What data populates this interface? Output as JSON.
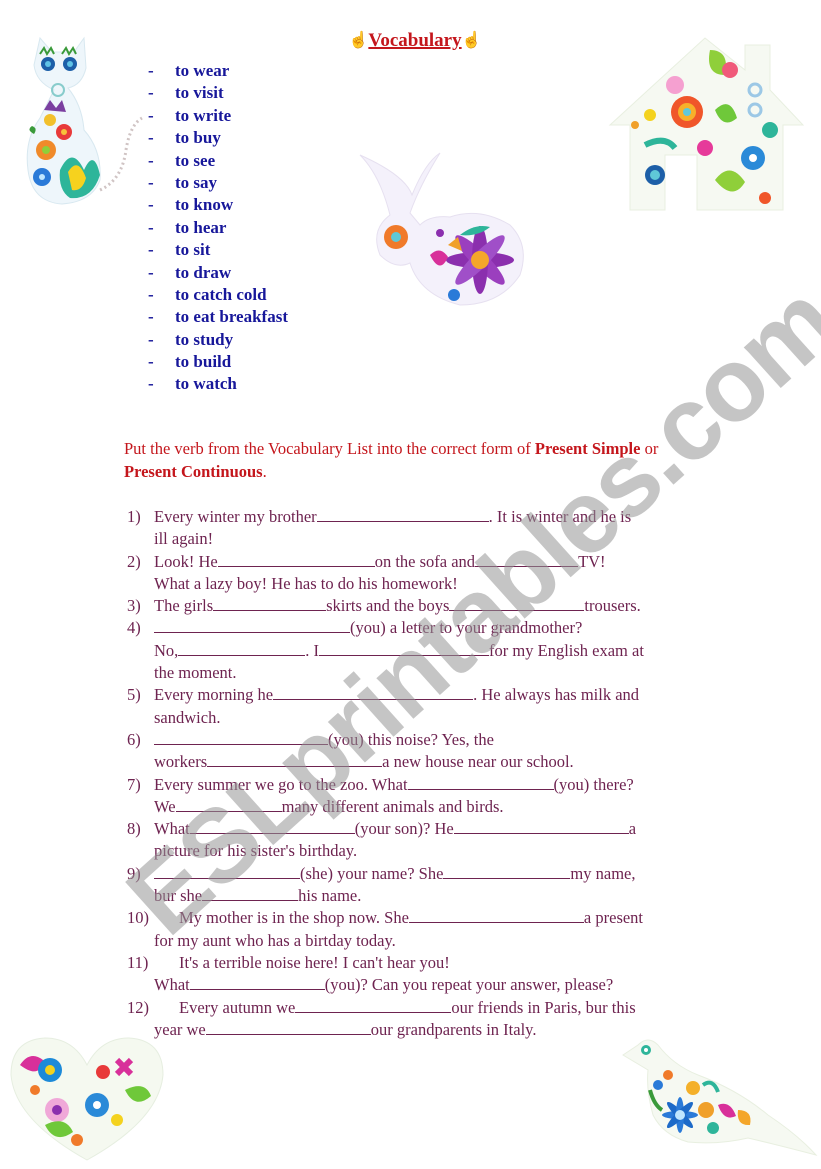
{
  "title": {
    "text": "Vocabulary",
    "left_icon": "pointing-hand-icon",
    "right_icon": "pointing-hand-icon",
    "color": "#c4161c"
  },
  "vocabulary": {
    "bullet": "-",
    "color": "#17179a",
    "items": [
      "to wear",
      "to visit",
      "to write",
      "to buy",
      "to see",
      "to say",
      "to know",
      "to hear",
      "to sit",
      "to draw",
      "to catch cold",
      "to eat breakfast",
      "to study",
      "to build",
      "to watch"
    ]
  },
  "instructions": {
    "part1": "Put the verb from the Vocabulary List into the correct form of ",
    "bold1": "Present Simple",
    "part2": " or ",
    "bold2": "Present Continuous",
    "part3": ".",
    "color": "#c4161c"
  },
  "exercises": {
    "color": "#6e2350",
    "items": [
      {
        "num": "1)",
        "a": "Every winter my brother",
        "b": ". It is winter and he is",
        "c": "ill again!"
      },
      {
        "num": "2)",
        "a": "Look! He",
        "b": "on the sofa and",
        "c": "TV!",
        "d": "What a lazy boy! He has to do his homework!"
      },
      {
        "num": "3)",
        "a": "The girls",
        "b": "skirts and the boys",
        "c": "trousers."
      },
      {
        "num": "4)",
        "a": "(you) a letter to your grandmother?",
        "b": "No,",
        "c": ". I",
        "d": "for my English exam at",
        "e": "the moment."
      },
      {
        "num": "5)",
        "a": "Every morning he",
        "b": ". He always has milk and",
        "c": "sandwich."
      },
      {
        "num": "6)",
        "a": "(you) this noise? Yes, the",
        "b": "workers",
        "c": "a new house near our school."
      },
      {
        "num": "7)",
        "a": "Every summer we go to the zoo. What",
        "b": "(you) there?",
        "c": "We",
        "d": "many different animals and birds."
      },
      {
        "num": "8)",
        "a": "What",
        "b": "(your son)? He",
        "c": "a",
        "d": "picture for his sister's birthday."
      },
      {
        "num": "9)",
        "a": "(she) your name? She",
        "b": "my name,",
        "c": "bur she",
        "d": "his name."
      },
      {
        "num": "10)",
        "a": "My mother is in the shop now. She",
        "b": "a present",
        "c": "for my aunt who has a birtday today."
      },
      {
        "num": "11)",
        "a": "It's a terrible noise here! I can't hear you!",
        "b": "What",
        "c": "(you)? Can you repeat your answer, please?"
      },
      {
        "num": "12)",
        "a": "Every autumn we",
        "b": "our friends in Paris, bur this",
        "c": "year we",
        "d": "our grandparents in Italy."
      }
    ]
  },
  "watermark": "ESLprintables.com",
  "illustrations": [
    {
      "name": "floral-cat-illustration"
    },
    {
      "name": "floral-rabbit-illustration"
    },
    {
      "name": "floral-house-illustration"
    },
    {
      "name": "floral-heart-illustration"
    },
    {
      "name": "floral-bird-illustration"
    }
  ]
}
